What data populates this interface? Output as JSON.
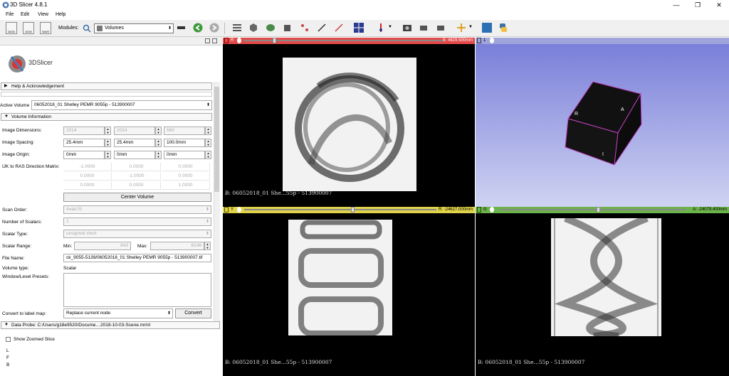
{
  "window": {
    "title": "3D Slicer 4.8.1",
    "minimize": "—",
    "restore": "❐",
    "close": "✕"
  },
  "menu": [
    "File",
    "Edit",
    "View",
    "Help"
  ],
  "toolbar": {
    "data_btn": "DATA",
    "dcm_btn": "DCM",
    "save_btn": "SAVE",
    "modules_label": "Modules:",
    "module_selected": "Volumes"
  },
  "logo": {
    "text": "3DSlicer"
  },
  "sections": {
    "help": "Help & Acknowledgement",
    "volume_info": "Volume Information",
    "data_probe": "Data Probe: C:/Users/g18e9520/Docume…2018-10-03-Scene.mrml"
  },
  "active_volume": {
    "label": "Active Volume",
    "value": "06052018_01 Shelley PEMR 9055p - 513900007"
  },
  "volume_info": {
    "dims_label": "Image Dimensions:",
    "dims": [
      "2014",
      "2024",
      "560"
    ],
    "spacing_label": "Image Spacing:",
    "spacing": [
      "25.4mm",
      "25.4mm",
      "100.0mm"
    ],
    "origin_label": "Image Origin:",
    "origin": [
      "0mm",
      "0mm",
      "0mm"
    ],
    "ijk_label": "IJK to RAS Direction Matrix:",
    "matrix": [
      [
        "-1.0000",
        "0.0000",
        "0.0000"
      ],
      [
        "0.0000",
        "-1.0000",
        "0.0000"
      ],
      [
        "0.0000",
        "0.0000",
        "1.0000"
      ]
    ],
    "center_btn": "Center Volume",
    "scan_order_label": "Scan Order:",
    "scan_order": "Axial IS",
    "num_scalars_label": "Number of Scalars:",
    "num_scalars": "1",
    "scalar_type_label": "Scalar Type:",
    "scalar_type": "unsigned short",
    "scalar_range_label": "Scalar Range:",
    "min_label": "Min:",
    "min": "843",
    "max_label": "Max:",
    "max": "8148",
    "file_name_label": "File Name:",
    "file_name": "ck_9055-5139/06052018_01 Shelley PEMR 9055p - 513900007.tif",
    "volume_type_label": "Volume type:",
    "volume_type": "Scalar",
    "wl_label": "Window/Level Presets:",
    "convert_label": "Convert to label map:",
    "convert_option": "Replace current node",
    "convert_btn": "Convert"
  },
  "data_probe": {
    "show_zoomed": "Show Zoomed Slice",
    "coords": [
      "L",
      "F",
      "B"
    ]
  },
  "views": {
    "red": {
      "id": "R",
      "readout": "S: 4629.500mm",
      "label": "B: 06052018_01 She...55p - 513900007",
      "color": "#e34a4a"
    },
    "threed": {
      "id": "1",
      "cube_labels": [
        "R",
        "A",
        "I"
      ]
    },
    "yellow": {
      "id": "Y",
      "readout": "R: -24627.000mm",
      "label": "B: 06052018_01 She...55p - 513900007",
      "color": "#e0d34a"
    },
    "green": {
      "id": "G",
      "readout": "A: -24079.400mm",
      "label": "B: 06052018_01 She...55p - 513900007",
      "color": "#6bb34a"
    }
  }
}
